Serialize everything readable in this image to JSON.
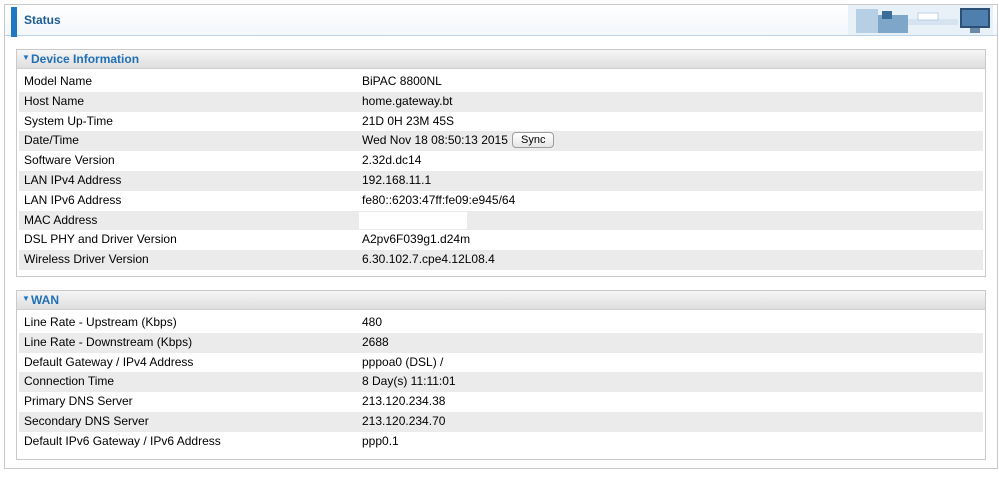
{
  "page": {
    "title": "Status"
  },
  "device_info": {
    "title": "Device Information",
    "rows": [
      {
        "label": "Model Name",
        "value": "BiPAC 8800NL"
      },
      {
        "label": "Host Name",
        "value": "home.gateway.bt"
      },
      {
        "label": "System Up-Time",
        "value": "21D 0H 23M 45S"
      },
      {
        "label": "Date/Time",
        "value": "Wed Nov 18 08:50:13 2015",
        "button": "Sync"
      },
      {
        "label": "Software Version",
        "value": "2.32d.dc14"
      },
      {
        "label": "LAN IPv4 Address",
        "value": "192.168.11.1"
      },
      {
        "label": "LAN IPv6 Address",
        "value": "fe80::6203:47ff:fe09:e945/64"
      },
      {
        "label": "MAC Address",
        "value": ""
      },
      {
        "label": "DSL PHY and Driver Version",
        "value": "A2pv6F039g1.d24m"
      },
      {
        "label": "Wireless Driver Version",
        "value": "6.30.102.7.cpe4.12L08.4"
      }
    ]
  },
  "wan": {
    "title": "WAN",
    "rows": [
      {
        "label": "Line Rate - Upstream (Kbps)",
        "value": "480"
      },
      {
        "label": "Line Rate - Downstream (Kbps)",
        "value": "2688"
      },
      {
        "label": "Default Gateway / IPv4 Address",
        "value": "pppoa0 (DSL) /"
      },
      {
        "label": "Connection Time",
        "value": "8 Day(s) 11:11:01"
      },
      {
        "label": "Primary DNS Server",
        "value": "213.120.234.38"
      },
      {
        "label": "Secondary DNS Server",
        "value": "213.120.234.70"
      },
      {
        "label": "Default IPv6 Gateway / IPv6 Address",
        "value": "ppp0.1"
      }
    ]
  },
  "icons": {
    "collapse": "triangle-down-icon",
    "header_graphic": "office-desk-illustration"
  }
}
